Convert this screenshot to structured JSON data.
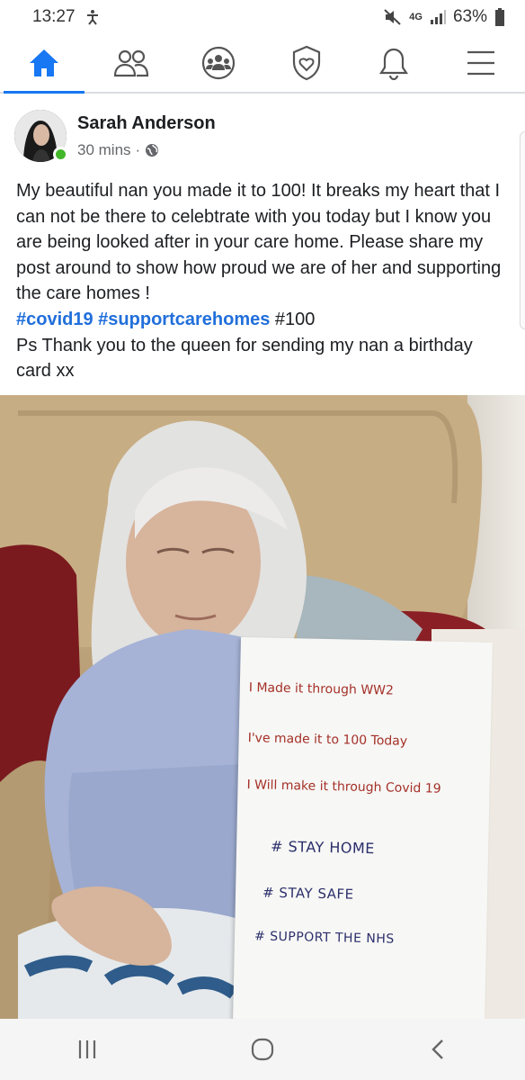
{
  "status_bar": {
    "time": "13:27",
    "network": "4G",
    "battery": "63%"
  },
  "top_nav": {
    "items": [
      {
        "name": "home",
        "icon": "home-icon",
        "active": true
      },
      {
        "name": "friends",
        "icon": "friends-icon",
        "active": false
      },
      {
        "name": "groups",
        "icon": "groups-icon",
        "active": false
      },
      {
        "name": "covid-info",
        "icon": "shield-heart-icon",
        "active": false
      },
      {
        "name": "notifications",
        "icon": "bell-icon",
        "active": false
      },
      {
        "name": "menu",
        "icon": "menu-icon",
        "active": false
      }
    ],
    "accent_color": "#1877f2"
  },
  "post": {
    "author": "Sarah Anderson",
    "time": "30 mins",
    "separator": "·",
    "privacy_icon": "globe-icon",
    "text_main": "My beautiful nan you made it to 100! It breaks my heart that I can not be there to celebtrate with you today but I know you are being looked after in your care home. Please share my post around to show how proud we are of her and supporting the care homes !",
    "hashtag1": "#covid19",
    "hashtag2": "#supportcarehomes",
    "tag3": "#100",
    "text_ps": "Ps Thank you to the queen for sending my nan a birthday card xx",
    "hashtag_color": "#216fdb",
    "sign": {
      "line1": "I   Made it through WW2",
      "line2": "I've made it to 100 Today",
      "line3": "I  Will make it through Covid 19",
      "line4": "# STAY HOME",
      "line5": "# STAY  SAFE",
      "line6": "# SUPPORT THE NHS"
    }
  },
  "system_nav": {
    "recents": "recents-icon",
    "home": "home-circle-icon",
    "back": "back-icon"
  }
}
